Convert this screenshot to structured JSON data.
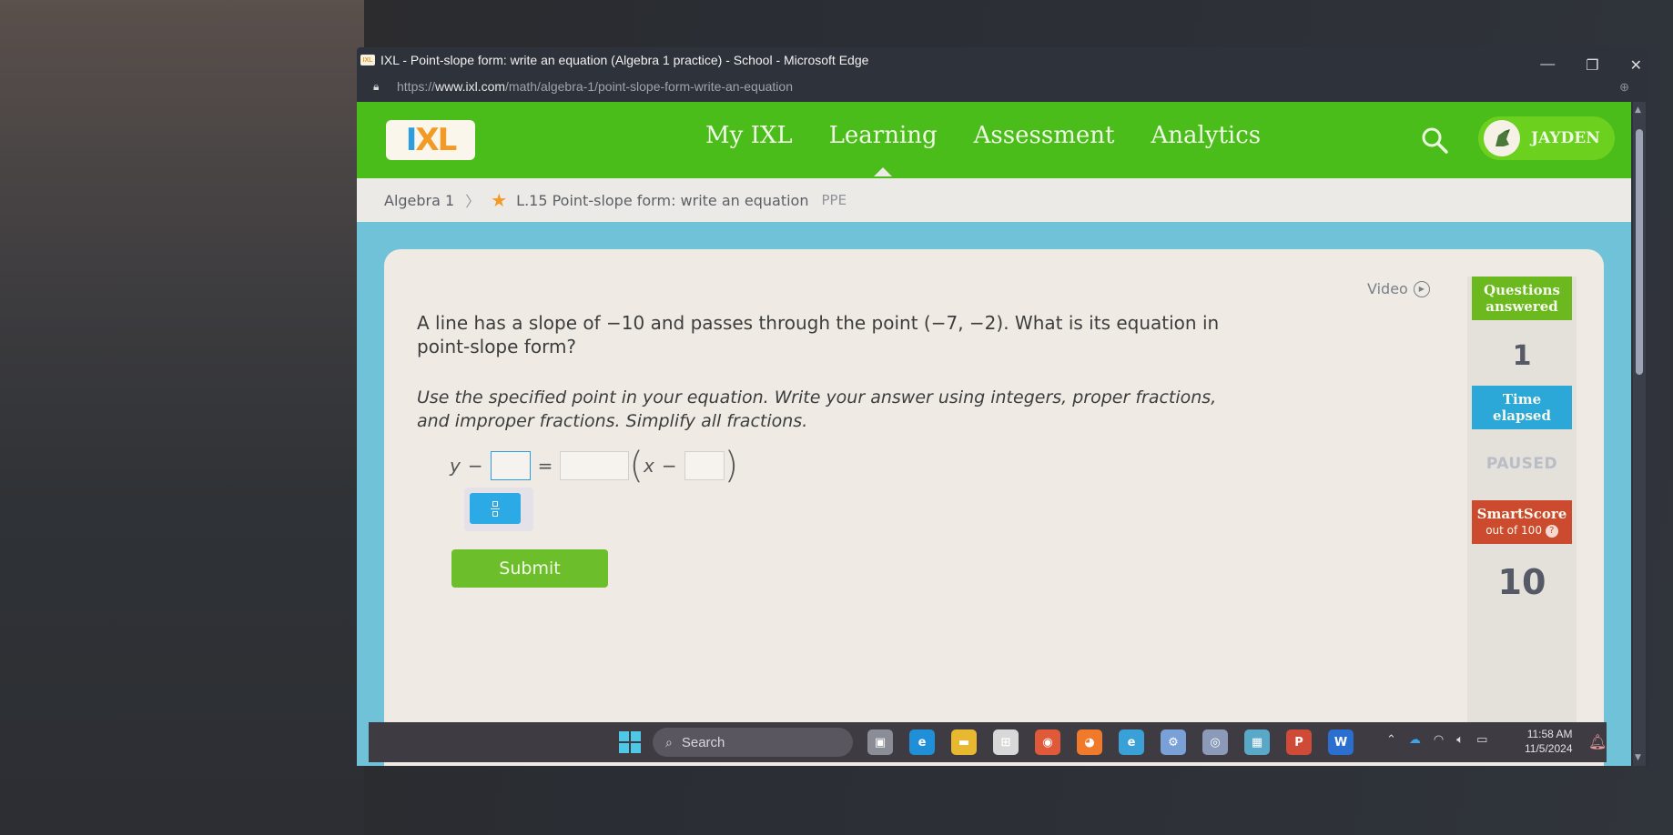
{
  "browser": {
    "window_title": "IXL - Point-slope form: write an equation (Algebra 1 practice) - School - Microsoft Edge",
    "favicon_text": "IXL",
    "url_scheme": "https://",
    "url_host": "www.ixl.com",
    "url_path": "/math/algebra-1/point-slope-form-write-an-equation",
    "controls": {
      "minimize": "—",
      "restore": "❐",
      "close": "✕"
    },
    "zoom_indicator": "⊕"
  },
  "header": {
    "logo_i": "I",
    "logo_xl": "XL",
    "nav": [
      {
        "label": "My IXL",
        "active": false
      },
      {
        "label": "Learning",
        "active": true
      },
      {
        "label": "Assessment",
        "active": false
      },
      {
        "label": "Analytics",
        "active": false
      }
    ],
    "user_name": "JAYDEN"
  },
  "breadcrumb": {
    "subject": "Algebra 1",
    "separator": "〉",
    "skill": "L.15 Point-slope form: write an equation",
    "skill_code": "PPE"
  },
  "question": {
    "prompt": "A line has a slope of −10 and passes through the point (−7, −2). What is its equation in point-slope form?",
    "instructions": "Use the specified point in your equation. Write your answer using integers, proper fractions, and improper fractions. Simplify all fractions.",
    "equation": {
      "y_var": "y",
      "minus1": "−",
      "equals": "=",
      "open_paren": "(",
      "x_var": "x",
      "minus2": "−",
      "close_paren": ")",
      "answer_y1": "",
      "answer_slope": "",
      "answer_x1": ""
    },
    "submit_label": "Submit"
  },
  "sidebar": {
    "video_label": "Video",
    "questions_answered_label_1": "Questions",
    "questions_answered_label_2": "answered",
    "questions_answered_value": "1",
    "time_elapsed_label_1": "Time",
    "time_elapsed_label_2": "elapsed",
    "time_status": "PAUSED",
    "smartscore_label": "SmartScore",
    "smartscore_sub": "out of 100",
    "smartscore_help": "?",
    "smartscore_value": "10"
  },
  "taskbar": {
    "search_placeholder": "Search",
    "apps": [
      {
        "name": "task-view",
        "glyph": "▣",
        "color": "#8a8d96"
      },
      {
        "name": "edge",
        "glyph": "e",
        "color": "#1f8fd8"
      },
      {
        "name": "file-explorer",
        "glyph": "▬",
        "color": "#e8b830"
      },
      {
        "name": "microsoft-store",
        "glyph": "⊞",
        "color": "#d8d8d8"
      },
      {
        "name": "chrome",
        "glyph": "◉",
        "color": "#e05a3a"
      },
      {
        "name": "firefox",
        "glyph": "◕",
        "color": "#f07a2a"
      },
      {
        "name": "internet-explorer",
        "glyph": "e",
        "color": "#3aa0d8"
      },
      {
        "name": "settings",
        "glyph": "⚙",
        "color": "#7aa0d8"
      },
      {
        "name": "camera",
        "glyph": "◎",
        "color": "#8a9ab8"
      },
      {
        "name": "calculator",
        "glyph": "▦",
        "color": "#5aa8c8"
      },
      {
        "name": "powerpoint",
        "glyph": "P",
        "color": "#d04a38"
      },
      {
        "name": "word",
        "glyph": "W",
        "color": "#2a6fd0"
      }
    ],
    "time": "11:58 AM",
    "date": "11/5/2024"
  }
}
